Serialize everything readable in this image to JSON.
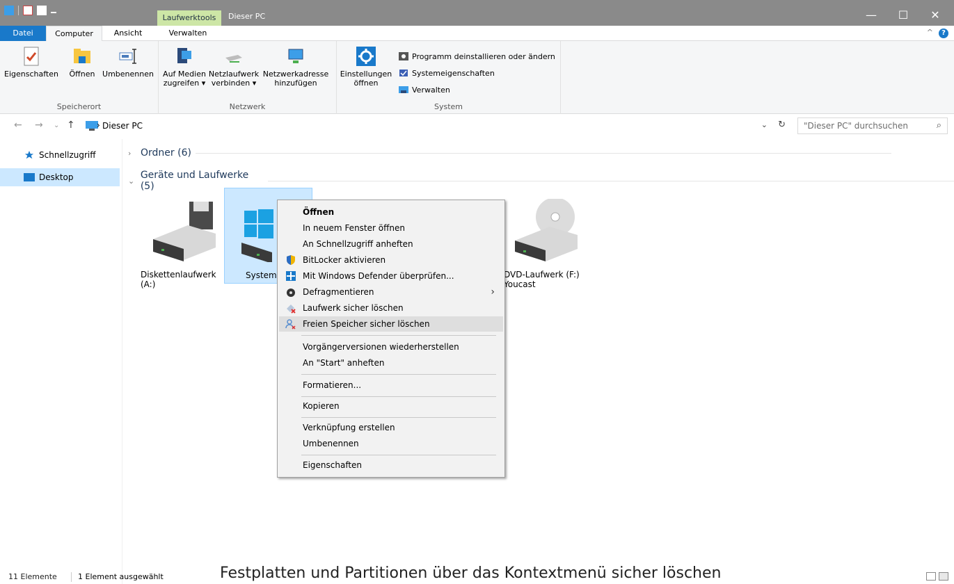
{
  "titlebar": {
    "contextual_tab": "Laufwerktools",
    "title": "Dieser PC",
    "min": "—",
    "max": "☐",
    "close": "✕"
  },
  "tabs": {
    "file": "Datei",
    "computer": "Computer",
    "view": "Ansicht",
    "manage": "Verwalten",
    "collapse": "^",
    "help": "?"
  },
  "ribbon": {
    "groups": {
      "location": "Speicherort",
      "network": "Netzwerk",
      "system": "System"
    },
    "properties": "Eigenschaften",
    "open": "Öffnen",
    "rename": "Umbenennen",
    "media_line1": "Auf Medien",
    "media_line2": "zugreifen ▾",
    "mapdrive_line1": "Netzlaufwerk",
    "mapdrive_line2": "verbinden ▾",
    "netaddr_line1": "Netzwerkadresse",
    "netaddr_line2": "hinzufügen",
    "settings_line1": "Einstellungen",
    "settings_line2": "öffnen",
    "uninstall": "Programm deinstallieren oder ändern",
    "sysprops": "Systemeigenschaften",
    "manage": "Verwalten"
  },
  "address": {
    "breadcrumb_sep": "›",
    "crumb": "Dieser PC",
    "search_placeholder": "\"Dieser PC\" durchsuchen"
  },
  "nav": {
    "quick_access": "Schnellzugriff",
    "desktop": "Desktop"
  },
  "main": {
    "folders_header": "Ordner (6)",
    "devices_header": "Geräte und Laufwerke (5)",
    "drives": [
      {
        "line1": "Diskettenlaufwerk",
        "line2": "(A:)"
      },
      {
        "line1": "System",
        "line2": ""
      },
      {
        "line1": "DVD-Laufwerk (F:)",
        "line2": "Youcast"
      }
    ]
  },
  "context_menu": {
    "items": [
      "Öffnen",
      "In neuem Fenster öffnen",
      "An Schnellzugriff anheften",
      "BitLocker aktivieren",
      "Mit Windows Defender überprüfen...",
      "Defragmentieren",
      "Laufwerk sicher löschen",
      "Freien Speicher sicher löschen",
      "Vorgängerversionen wiederherstellen",
      "An \"Start\" anheften",
      "Formatieren...",
      "Kopieren",
      "Verknüpfung erstellen",
      "Umbenennen",
      "Eigenschaften"
    ],
    "submenu_arrow": "›"
  },
  "status": {
    "items_count": "11 Elemente",
    "selected": "1 Element ausgewählt"
  },
  "caption": "Festplatten und Partitionen über das Kontextmenü sicher löschen",
  "colors": {
    "file_tab": "#1979ca",
    "contextual_tab": "#cde6a6",
    "selection": "#cce8ff",
    "titlebar": "#8a8a8a"
  }
}
